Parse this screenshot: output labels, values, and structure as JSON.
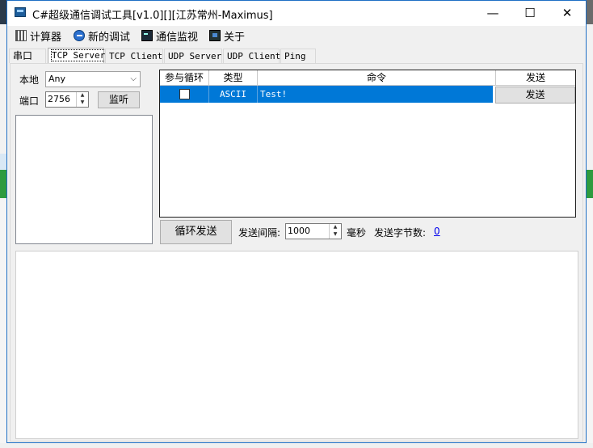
{
  "window": {
    "title": "C#超级通信调试工具[v1.0][][江苏常州-Maximus]",
    "minimize_glyph": "—",
    "maximize_glyph": "☐",
    "close_glyph": "✕"
  },
  "menu": [
    {
      "label": "计算器",
      "icon": "calculator-icon"
    },
    {
      "label": "新的调试",
      "icon": "globe-icon"
    },
    {
      "label": "通信监视",
      "icon": "terminal-icon"
    },
    {
      "label": "关于",
      "icon": "info-icon"
    }
  ],
  "tabs": [
    {
      "label": "串口",
      "active": false
    },
    {
      "label": "TCP Server",
      "active": true
    },
    {
      "label": "TCP Client",
      "active": false
    },
    {
      "label": "UDP Server",
      "active": false
    },
    {
      "label": "UDP Client",
      "active": false
    },
    {
      "label": "Ping",
      "active": false
    }
  ],
  "server": {
    "local_label": "本地",
    "local_value": "Any",
    "port_label": "端口",
    "port_value": "2756",
    "listen_button": "监听"
  },
  "grid": {
    "columns": [
      "参与循环",
      "类型",
      "命令",
      "发送"
    ],
    "rows": [
      {
        "loop": false,
        "type": "ASCII",
        "command": "Test!",
        "send_label": "发送"
      }
    ]
  },
  "loop_send": {
    "button": "循环发送",
    "interval_label": "发送间隔:",
    "interval_value": "1000",
    "interval_unit": "毫秒",
    "bytes_label": "发送字节数:",
    "bytes_value": "0"
  },
  "colors": {
    "selection": "#0078d7",
    "accent_border": "#1e6fc5"
  }
}
